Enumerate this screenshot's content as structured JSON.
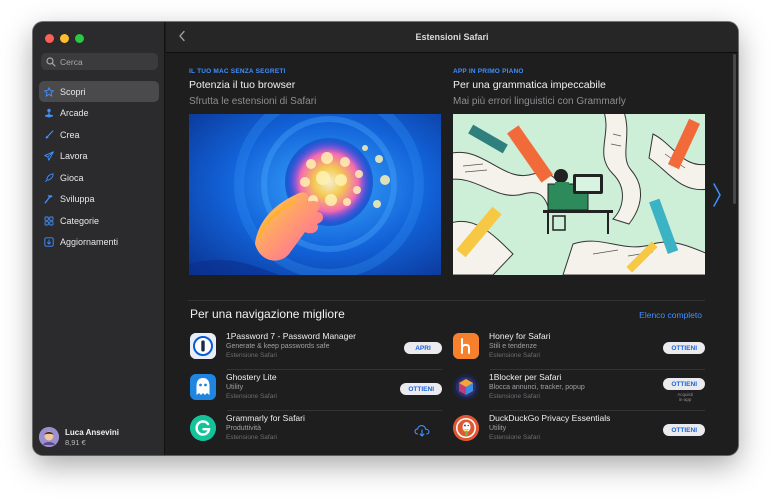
{
  "sidebar": {
    "search_placeholder": "Cerca",
    "items": [
      {
        "label": "Scopri",
        "icon": "star-icon",
        "active": true
      },
      {
        "label": "Arcade",
        "icon": "joystick-icon",
        "active": false
      },
      {
        "label": "Crea",
        "icon": "brush-icon",
        "active": false
      },
      {
        "label": "Lavora",
        "icon": "paperplane-icon",
        "active": false
      },
      {
        "label": "Gioca",
        "icon": "rocket-icon",
        "active": false
      },
      {
        "label": "Sviluppa",
        "icon": "hammer-icon",
        "active": false
      },
      {
        "label": "Categorie",
        "icon": "grid-icon",
        "active": false
      },
      {
        "label": "Aggiornamenti",
        "icon": "download-icon",
        "active": false
      }
    ],
    "user": {
      "name": "Luca Ansevini",
      "balance": "8,91 €"
    }
  },
  "header": {
    "title": "Estensioni Safari"
  },
  "features": [
    {
      "kicker": "IL TUO MAC SENZA SEGRETI",
      "headline": "Potenzia il tuo browser",
      "subtitle": "Sfrutta le estensioni di Safari"
    },
    {
      "kicker": "APP IN PRIMO PIANO",
      "headline": "Per una grammatica impeccabile",
      "subtitle": "Mai più errori linguistici con Grammarly"
    }
  ],
  "section": {
    "title": "Per una navigazione migliore",
    "see_all": "Elenco completo",
    "apps": [
      {
        "name": "1Password 7 - Password Manager",
        "category": "Generate & keep passwords safe",
        "type": "Estensione Safari",
        "action": "APRI",
        "icon": "1password-icon"
      },
      {
        "name": "Honey for Safari",
        "category": "Stili e tendenze",
        "type": "Estensione Safari",
        "action": "OTTIENI",
        "icon": "honey-icon"
      },
      {
        "name": "Ghostery Lite",
        "category": "Utility",
        "type": "Estensione Safari",
        "action": "OTTIENI",
        "icon": "ghost-icon"
      },
      {
        "name": "1Blocker per Safari",
        "category": "Blocca annunci, tracker, popup",
        "type": "Estensione Safari",
        "action": "OTTIENI",
        "iap": "Acquisti\nin-app",
        "icon": "blocker-icon"
      },
      {
        "name": "Grammarly for Safari",
        "category": "Produttività",
        "type": "Estensione Safari",
        "action": "",
        "icon": "grammarly-icon"
      },
      {
        "name": "DuckDuckGo Privacy Essentials",
        "category": "Utility",
        "type": "Estensione Safari",
        "action": "OTTIENI",
        "icon": "duckduckgo-icon"
      }
    ]
  },
  "colors": {
    "accent": "#3f90ff",
    "sidebar_bg": "#2b2a2c",
    "main_bg": "#1e1e1f"
  }
}
